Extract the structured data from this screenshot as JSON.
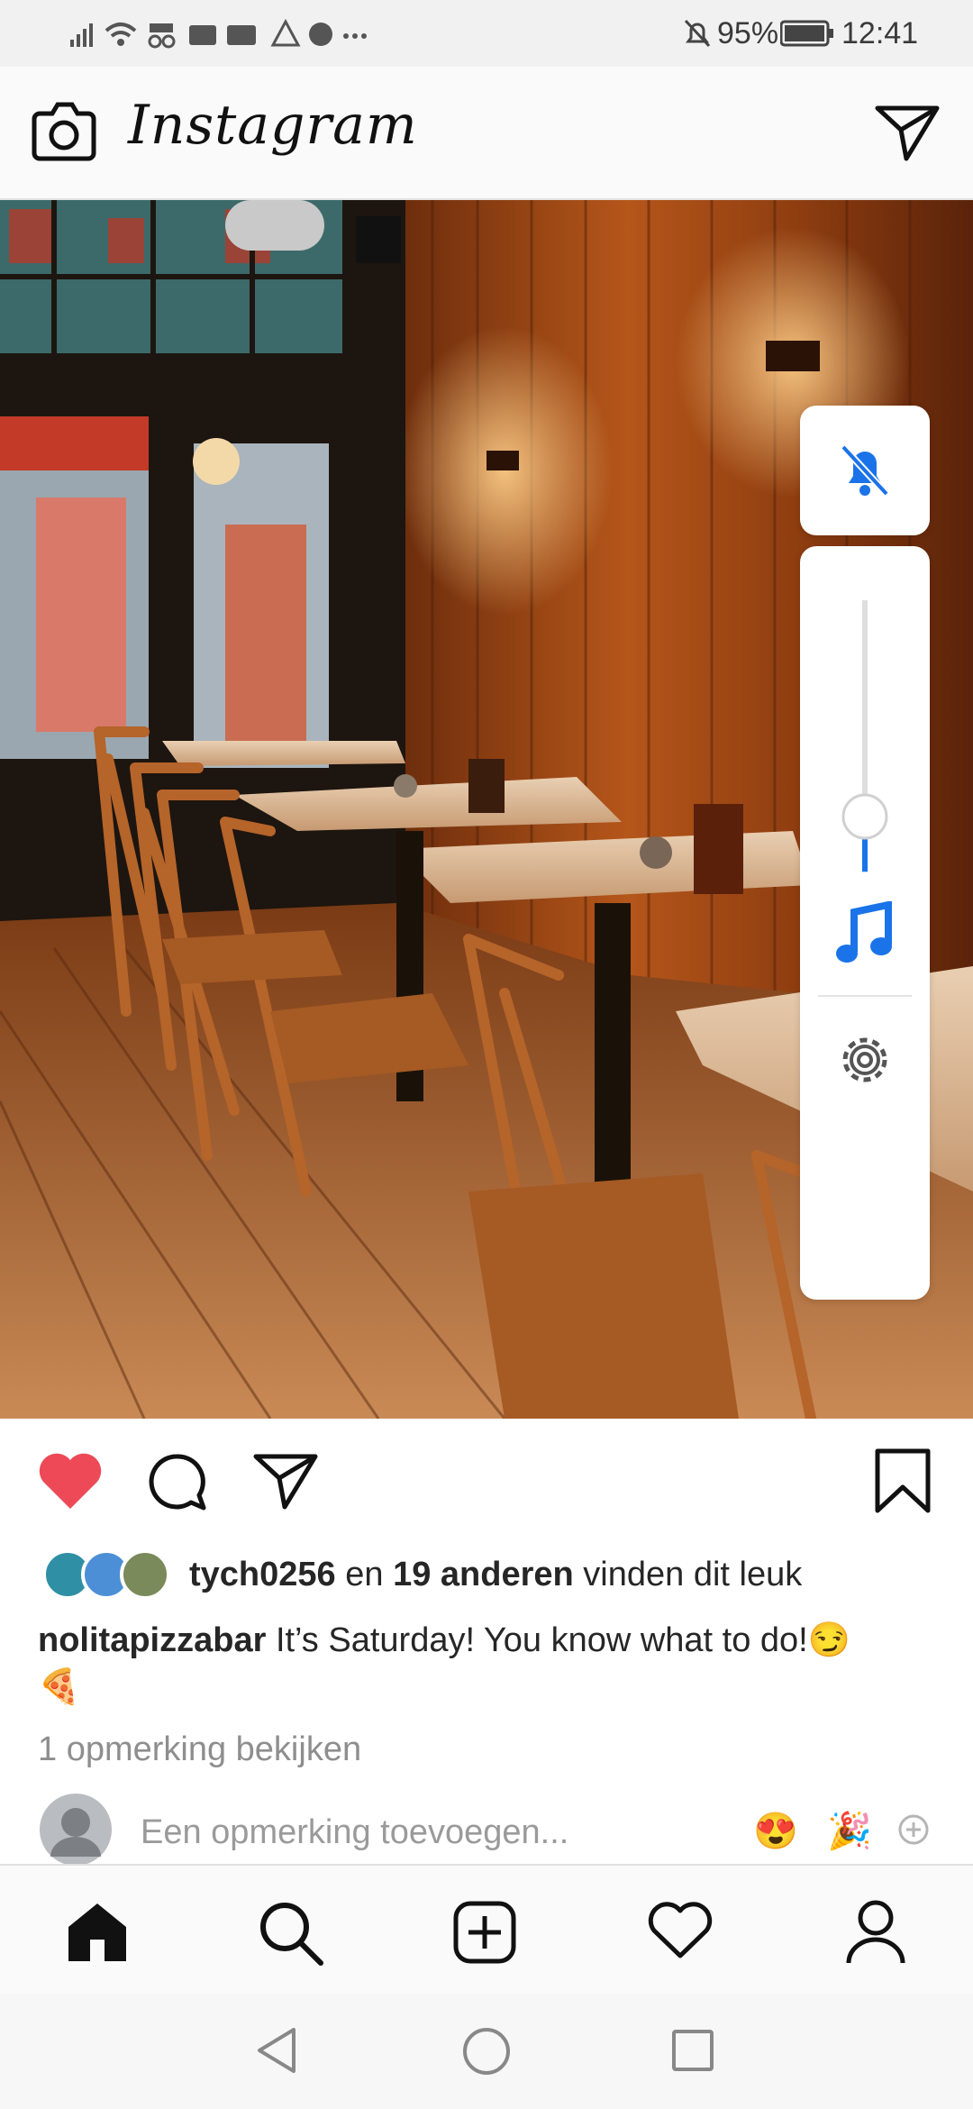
{
  "status_bar": {
    "battery": "95%",
    "time": "12:41"
  },
  "header": {
    "app_name": "Instagram"
  },
  "post": {
    "likes": {
      "first_user": "tych0256",
      "connector": "en",
      "others": "19 anderen",
      "suffix": "vinden dit leuk"
    },
    "caption": {
      "username": "nolitapizzabar",
      "text": "It’s Saturday! You know what to do!😏",
      "line2": "🍕"
    },
    "view_comments": "1 opmerking bekijken",
    "comment_input": {
      "placeholder": "Een opmerking toevoegen...",
      "quick_emoji_1": "😍",
      "quick_emoji_2": "🎉"
    }
  },
  "volume_panel": {
    "level": 0.24
  },
  "colors": {
    "accent_blue": "#1a73e8",
    "like_red": "#ed4956"
  }
}
